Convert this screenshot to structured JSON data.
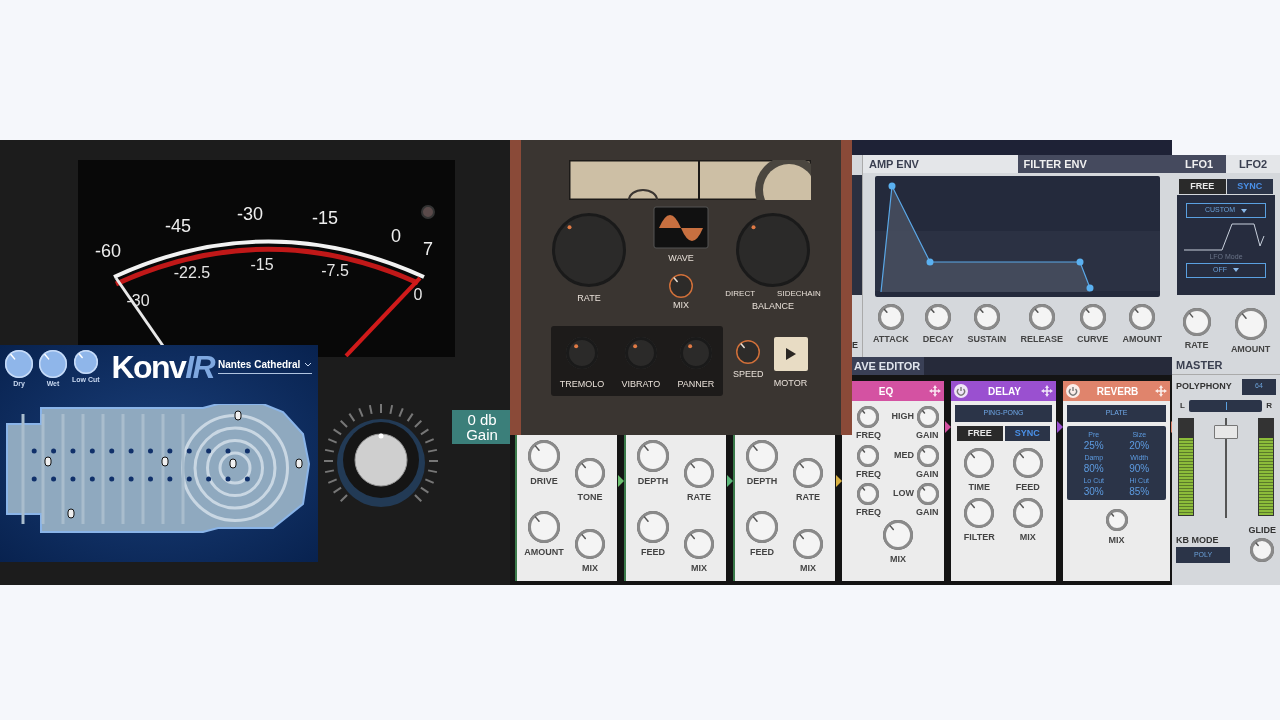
{
  "meter": {
    "top_scale": [
      "-60",
      "-45",
      "-30",
      "-15",
      "0",
      "7"
    ],
    "bottom_scale": [
      "-30",
      "-22.5",
      "-15",
      "-7.5",
      "0"
    ]
  },
  "gain": {
    "value": "0 db",
    "label": "Gain"
  },
  "konvir": {
    "knobs": [
      {
        "label": "Dry"
      },
      {
        "label": "Wet"
      },
      {
        "label": "Low Cut"
      }
    ],
    "logo": "Konv",
    "logo_accent": "IR",
    "preset": "Nantes Cathedral"
  },
  "modulator": {
    "rate": {
      "label": "RATE"
    },
    "wave": "WAVE",
    "mix": {
      "label": "MIX"
    },
    "balance": {
      "label": "BALANCE",
      "left": "DIRECT",
      "right": "SIDECHAIN"
    },
    "modes": [
      {
        "label": "TREMOLO"
      },
      {
        "label": "VIBRATO"
      },
      {
        "label": "PANNER"
      }
    ],
    "speed": {
      "label": "SPEED"
    },
    "motor": "MOTOR"
  },
  "wave_editor": "AVE EDITOR",
  "chain": [
    {
      "kind": "pair",
      "color": "#6cc070",
      "knobs": [
        {
          "label": "DRIVE"
        },
        {
          "label": "TONE"
        },
        {
          "label": "AMOUNT"
        },
        {
          "label": "MIX"
        }
      ]
    },
    {
      "kind": "pair",
      "color": "#5cb87a",
      "knobs": [
        {
          "label": "DEPTH"
        },
        {
          "label": "RATE"
        },
        {
          "label": "FEED"
        },
        {
          "label": "MIX"
        }
      ]
    },
    {
      "kind": "pair",
      "color": "#d8b040",
      "knobs": [
        {
          "label": "DEPTH"
        },
        {
          "label": "RATE"
        },
        {
          "label": "FEED"
        },
        {
          "label": "MIX"
        }
      ]
    },
    {
      "kind": "eq",
      "color": "#d452a2",
      "title": "EQ",
      "bands": [
        {
          "label": "HIGH",
          "freq": "FREQ",
          "gain": "GAIN"
        },
        {
          "label": "MED",
          "freq": "FREQ",
          "gain": "GAIN"
        },
        {
          "label": "LOW",
          "freq": "FREQ",
          "gain": "GAIN"
        }
      ],
      "mix": {
        "label": "MIX"
      }
    },
    {
      "kind": "delay",
      "color": "#9a50d0",
      "title": "DELAY",
      "mode": "PING-PONG",
      "sync": [
        {
          "label": "FREE",
          "selected": false
        },
        {
          "label": "SYNC",
          "selected": true
        }
      ],
      "knobs": [
        {
          "label": "TIME"
        },
        {
          "label": "FEED"
        },
        {
          "label": "FILTER"
        },
        {
          "label": "MIX"
        }
      ]
    },
    {
      "kind": "reverb",
      "color": "#e0846c",
      "title": "REVERB",
      "mode": "PLATE",
      "params": [
        {
          "label": "Pre",
          "value": "25%"
        },
        {
          "label": "Size",
          "value": "20%"
        },
        {
          "label": "Damp",
          "value": "80%"
        },
        {
          "label": "Width",
          "value": "90%"
        },
        {
          "label": "Lo Cut",
          "value": "30%"
        },
        {
          "label": "Hi Cut",
          "value": "85%"
        }
      ],
      "mix": {
        "label": "MIX"
      }
    }
  ],
  "synth": {
    "edge_label": "E",
    "env_tabs": [
      {
        "label": "AMP ENV",
        "selected": true
      },
      {
        "label": "FILTER ENV",
        "selected": false
      }
    ],
    "env_knobs": [
      {
        "label": "ATTACK"
      },
      {
        "label": "DECAY"
      },
      {
        "label": "SUSTAIN"
      },
      {
        "label": "RELEASE"
      },
      {
        "label": "CURVE"
      },
      {
        "label": "AMOUNT"
      }
    ],
    "lfo_tabs": [
      {
        "label": "LFO1",
        "selected": false
      },
      {
        "label": "LFO2",
        "selected": true
      }
    ],
    "lfo_sync": [
      {
        "label": "FREE",
        "selected": false
      },
      {
        "label": "SYNC",
        "selected": true
      }
    ],
    "lfo_shape": "CUSTOM",
    "lfo_mode_label": "LFO Mode",
    "lfo_mode": "OFF",
    "lfo_knobs": [
      {
        "label": "RATE"
      },
      {
        "label": "AMOUNT"
      }
    ]
  },
  "master": {
    "title": "MASTER",
    "polyphony_label": "POLYPHONY",
    "polyphony": "64",
    "pan_left": "L",
    "pan_right": "R",
    "meters": [
      {
        "level": 0.8
      },
      {
        "level": 0.8
      }
    ],
    "kb_mode_label": "KB MODE",
    "kb_mode": "POLY",
    "glide": {
      "label": "GLIDE"
    }
  }
}
